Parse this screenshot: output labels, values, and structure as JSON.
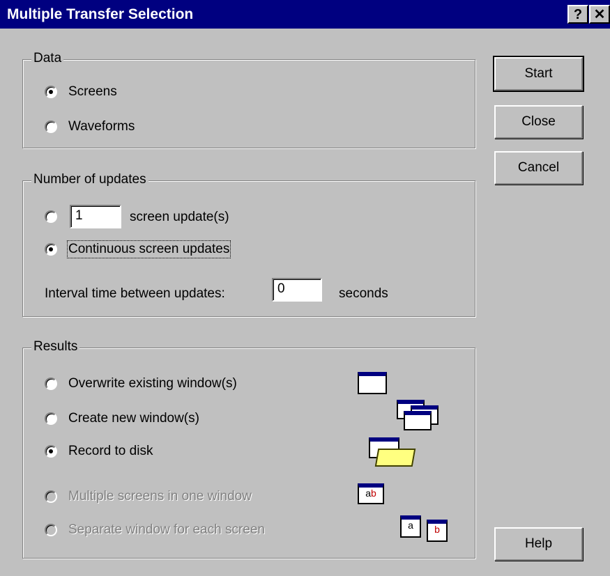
{
  "window": {
    "title": "Multiple Transfer Selection",
    "help_glyph": "?",
    "close_glyph": "✕"
  },
  "data_group": {
    "label": "Data",
    "options": [
      {
        "label": "Screens",
        "checked": true
      },
      {
        "label": "Waveforms",
        "checked": false
      }
    ]
  },
  "updates_group": {
    "label": "Number of updates",
    "count_value": "1",
    "count_suffix": "screen update(s)",
    "continuous_label": "Continuous screen updates",
    "interval_label": "Interval time between updates:",
    "interval_value": "0",
    "interval_units": "seconds"
  },
  "results_group": {
    "label": "Results",
    "options": [
      {
        "label": "Overwrite existing window(s)",
        "checked": false,
        "enabled": true
      },
      {
        "label": "Create new window(s)",
        "checked": false,
        "enabled": true
      },
      {
        "label": "Record to disk",
        "checked": true,
        "enabled": true
      },
      {
        "label": "Multiple screens in one window",
        "checked": false,
        "enabled": false
      },
      {
        "label": "Separate window for each screen",
        "checked": false,
        "enabled": false
      }
    ],
    "icon_letters": {
      "a": "a",
      "b": "b"
    }
  },
  "buttons": {
    "start": "Start",
    "close": "Close",
    "cancel": "Cancel",
    "help": "Help"
  }
}
